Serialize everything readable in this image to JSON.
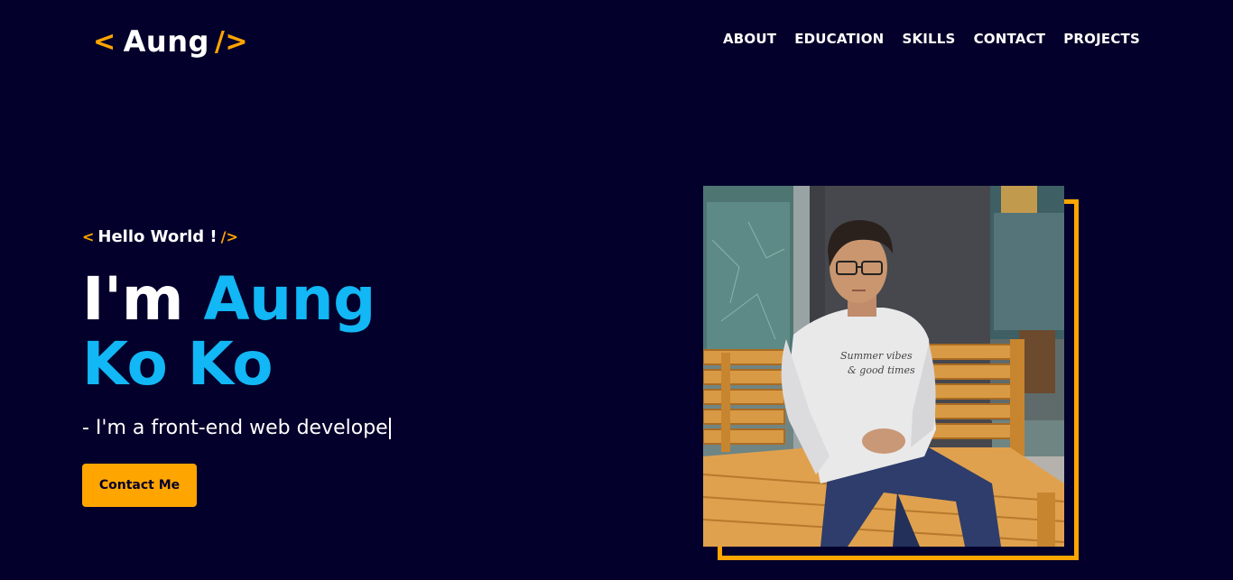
{
  "logo": {
    "open_bracket": "<",
    "name": "Aung",
    "close_bracket": "/>"
  },
  "nav": {
    "items": [
      "ABOUT",
      "EDUCATION",
      "SKILLS",
      "CONTACT",
      "PROJECTS"
    ]
  },
  "hero": {
    "greeting_open": "<",
    "greeting": "Hello World !",
    "greeting_close": "/>",
    "im": "I'm",
    "name_line1": "Aung",
    "name_line2": "Ko Ko",
    "tagline": "- I'm a front-end web develope",
    "cta_label": "Contact Me"
  },
  "photo": {
    "shirt_text_line1": "Summer vibes",
    "shirt_text_line2": "& good times"
  },
  "colors": {
    "background": "#03002b",
    "accent": "#ffa500",
    "highlight": "#12b7f5",
    "text": "#ffffff"
  }
}
